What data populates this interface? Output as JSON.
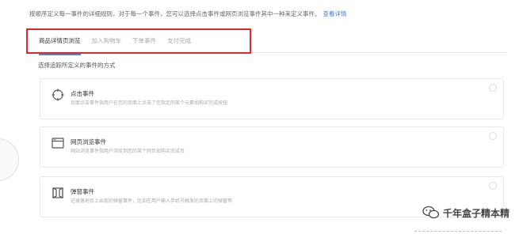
{
  "intro": {
    "text": "按顺序定义每一事件的详细规则，对于每一个事件，您可以选择点击事件或网页浏览事件其中一种来定义事件。",
    "link": "查看详情"
  },
  "tabs": [
    {
      "label": "商品详情页浏览",
      "active": true
    },
    {
      "label": "加入购物车",
      "active": false
    },
    {
      "label": "下单事件",
      "active": false
    },
    {
      "label": "支付完成",
      "active": false
    }
  ],
  "subtitle": "选择追踪所定义的事件的方式",
  "cards": [
    {
      "icon": "target-icon",
      "name": "点击事件",
      "desc": "页面点击事件指用户在您的页面上点击了您指定的某个元素如购买完成按钮"
    },
    {
      "icon": "browser-icon",
      "name": "网页浏览事件",
      "desc": "网站浏览事件指用户浏览到您的某个网页如购买完成页"
    },
    {
      "icon": "popup-icon",
      "name": "弹窗事件",
      "desc": "记录落地页上出现的弹窗事件，比如在用户输入手机号触发的页面上的弹窗等"
    }
  ],
  "watermark": {
    "text": "千年盒子精本精",
    "icon": "wechat-icon"
  },
  "colors": {
    "accent": "#3b8fd9",
    "highlight": "#e02a2a",
    "link": "#3f7fd8"
  }
}
